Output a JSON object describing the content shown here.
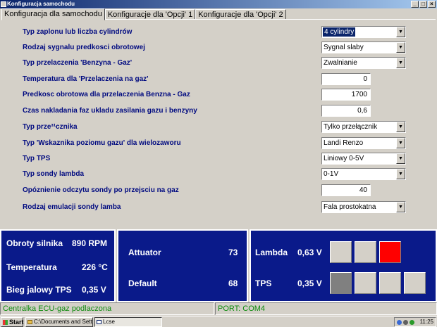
{
  "window": {
    "title": "Konfiguracja samochodu",
    "buttons": {
      "minimize": "_",
      "maximize": "□",
      "close": "×"
    }
  },
  "tabs": [
    {
      "label": "Konfiguracja dla samochodu",
      "active": true
    },
    {
      "label": "Konfiguracje dla 'Opcji' 1",
      "active": false
    },
    {
      "label": "Konfiguracje dla 'Opcji' 2",
      "active": false
    }
  ],
  "form": {
    "rows": [
      {
        "label": "Typ zaplonu lub liczba cylindrów",
        "type": "select",
        "value": "4 cylindry",
        "selected": true
      },
      {
        "label": "Rodzaj sygnalu predkosci obrotowej",
        "type": "select",
        "value": "Sygnal slaby"
      },
      {
        "label": "Typ przelaczenia 'Benzyna - Gaz'",
        "type": "select",
        "value": "Zwalnianie"
      },
      {
        "label": "Temperatura dla 'Przelaczenia na gaz'",
        "type": "number",
        "value": "0"
      },
      {
        "label": "Predkosc obrotowa dla przelaczenia Benzna - Gaz",
        "type": "number",
        "value": "1700"
      },
      {
        "label": "Czas nakladania faz ukladu zasilania gazu i benzyny",
        "type": "number",
        "value": "0,6"
      },
      {
        "label": "Typ prze³¹cznika",
        "type": "select",
        "value": "Tylko przełącznik"
      },
      {
        "label": "Typ 'Wskaznika poziomu gazu' dla wielozaworu",
        "type": "select",
        "value": "Landi Renzo"
      },
      {
        "label": "Typ TPS",
        "type": "select",
        "value": "Liniowy 0-5V"
      },
      {
        "label": "Typ sondy lambda",
        "type": "select",
        "value": "0-1V"
      },
      {
        "label": "Opóznienie odczytu sondy po przejsciu na gaz",
        "type": "number",
        "value": "40"
      },
      {
        "label": "Rodzaj emulacji sondy lamba",
        "type": "select",
        "value": "Fala prostokatna"
      }
    ]
  },
  "panels": {
    "engine": {
      "rpm_label": "Obroty silnika",
      "rpm_value": "890 RPM",
      "temp_label": "Temperatura",
      "temp_value": "226 °C",
      "tps_idle_label": "Bieg jalowy TPS",
      "tps_idle_value": "0,35 V"
    },
    "actuator": {
      "attuator_label": "Attuator",
      "attuator_value": "73",
      "default_label": "Default",
      "default_value": "68"
    },
    "sensors": {
      "lambda_label": "Lambda",
      "lambda_value": "0,63 V",
      "tps_label": "TPS",
      "tps_value": "0,35 V",
      "lambda_indicators": [
        "#d4d0c8",
        "#d4d0c8",
        "#ff0000"
      ],
      "tps_indicators": [
        "#808080",
        "#d4d0c8",
        "#d4d0c8",
        "#d4d0c8"
      ]
    }
  },
  "status": {
    "connection": "Centralka ECU-gaz podlaczona",
    "port": "PORT: COM4"
  },
  "taskbar": {
    "start": "Start",
    "tasks": [
      "C:\\Documents and Settin...",
      "Lcse"
    ],
    "clock": "11:25"
  }
}
